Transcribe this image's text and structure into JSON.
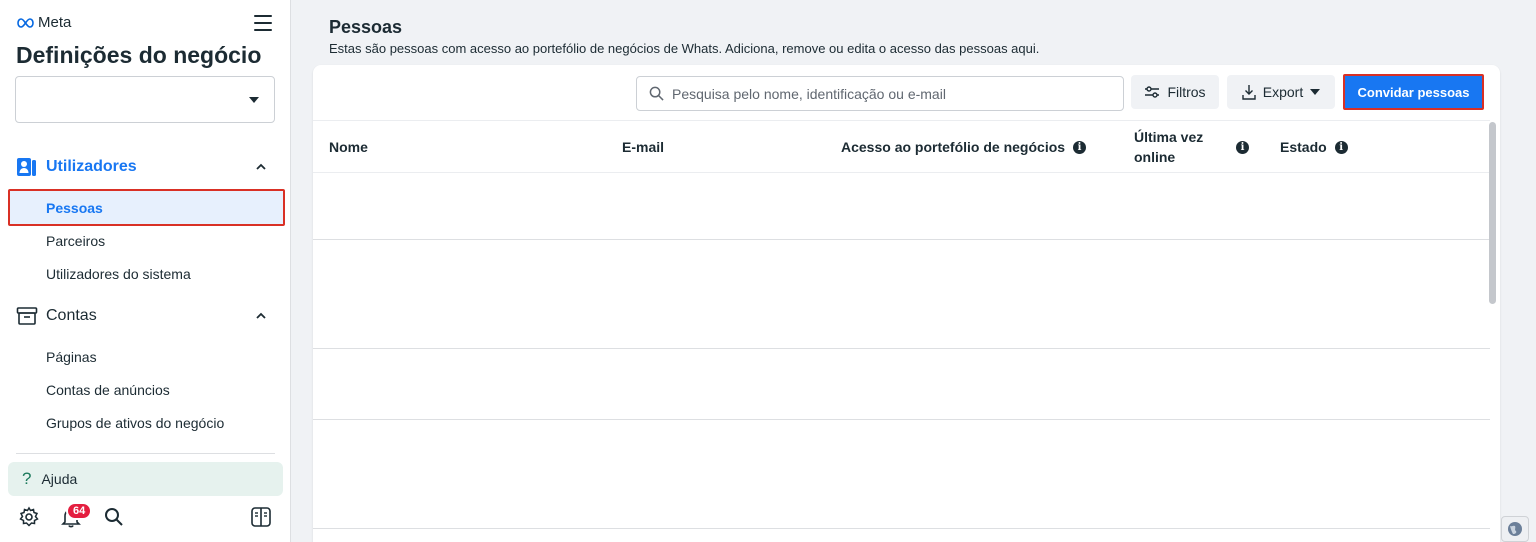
{
  "sidebar": {
    "brand": "Meta",
    "title": "Definições do negócio",
    "sections": {
      "users": {
        "label": "Utilizadores",
        "items": [
          "Pessoas",
          "Parceiros",
          "Utilizadores do sistema"
        ]
      },
      "accounts": {
        "label": "Contas",
        "items": [
          "Páginas",
          "Contas de anúncios",
          "Grupos de ativos do negócio"
        ]
      }
    },
    "help_label": "Ajuda",
    "notification_count": "64",
    "icons": [
      "gear-icon",
      "bell-icon",
      "search-icon",
      "panel-icon"
    ]
  },
  "main": {
    "title": "Pessoas",
    "subtitle": "Estas são pessoas com acesso ao portefólio de negócios de Whats. Adiciona, remove ou edita o acesso das pessoas aqui.",
    "search_placeholder": "Pesquisa pelo nome, identificação ou e-mail",
    "filters_label": "Filtros",
    "export_label": "Export",
    "invite_label": "Convidar pessoas",
    "columns": {
      "name": "Nome",
      "email": "E-mail",
      "access": "Acesso ao portefólio de negócios",
      "last_online": "Última vez online",
      "status": "Estado"
    }
  },
  "colors": {
    "accent": "#1877f2",
    "highlight_border": "#d93025",
    "help_bg": "#e6f2ee",
    "badge": "#e41e3f"
  }
}
